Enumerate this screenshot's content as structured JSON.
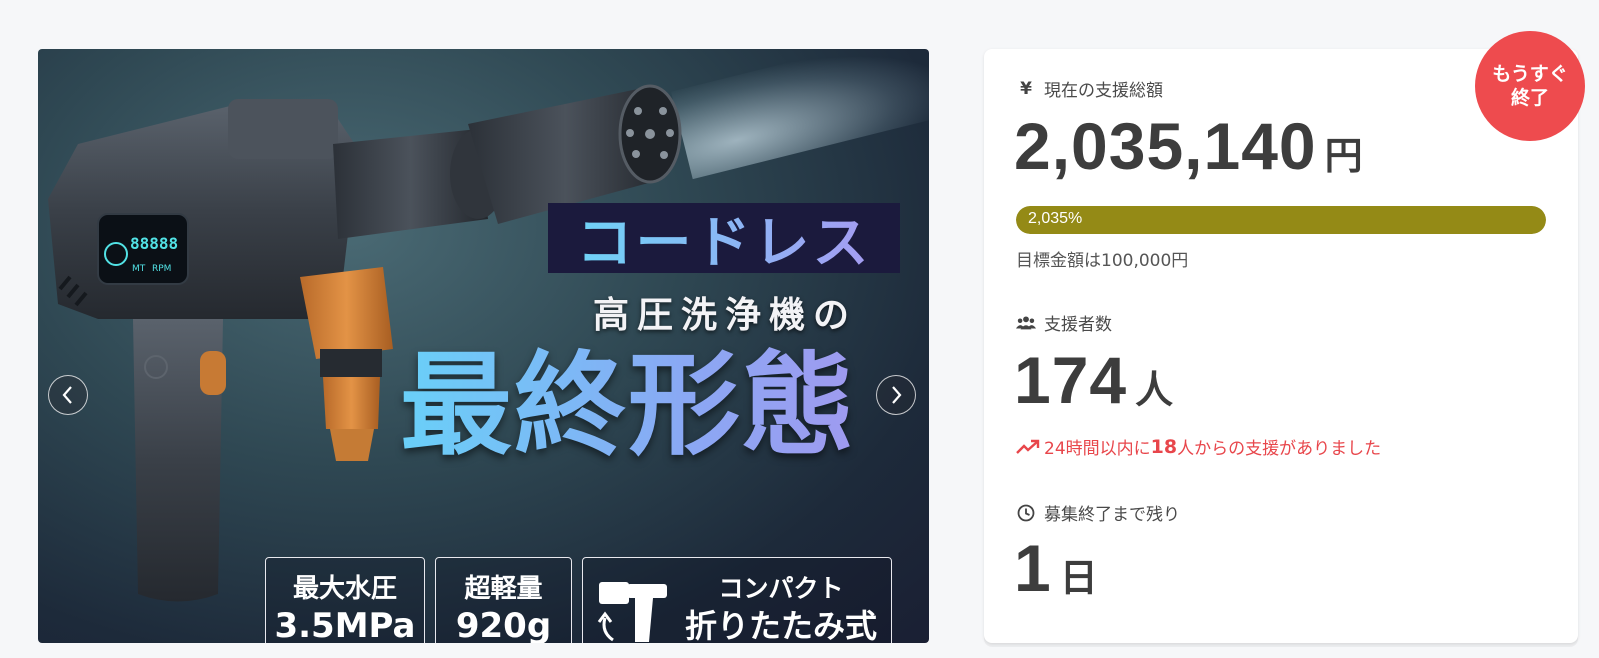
{
  "hero": {
    "title": "コードレス",
    "subtitle": "高圧洗浄機の",
    "headline": "最終形態",
    "display_digits": "88888",
    "display_unit": "RPM",
    "display_tag": "MT",
    "features": [
      {
        "line1": "最大水圧",
        "line2": "3.5MPa"
      },
      {
        "line1": "超軽量",
        "line2": "920g"
      },
      {
        "line1": "コンパクト",
        "line2": "折りたたみ式"
      }
    ],
    "prev_icon": "chevron-left-icon",
    "next_icon": "chevron-right-icon"
  },
  "badge": {
    "text": "もうすぐ\n終了",
    "color": "#ee4b4e"
  },
  "stats": {
    "total": {
      "label": "現在の支援総額",
      "icon": "yen-icon",
      "value": "2,035,140",
      "unit": "円"
    },
    "progress": {
      "text": "2,035%",
      "fraction": 1.0,
      "color": "#948a16"
    },
    "goal": "目標金額は100,000円",
    "supporters": {
      "label": "支援者数",
      "icon": "users-icon",
      "value": "174",
      "unit": "人"
    },
    "recent": {
      "icon": "trend-up-icon",
      "prefix": "24時間以内に",
      "count": "18",
      "suffix": "人からの支援がありました"
    },
    "remaining": {
      "label": "募集終了まで残り",
      "icon": "clock-icon",
      "value": "1",
      "unit": "日"
    }
  }
}
